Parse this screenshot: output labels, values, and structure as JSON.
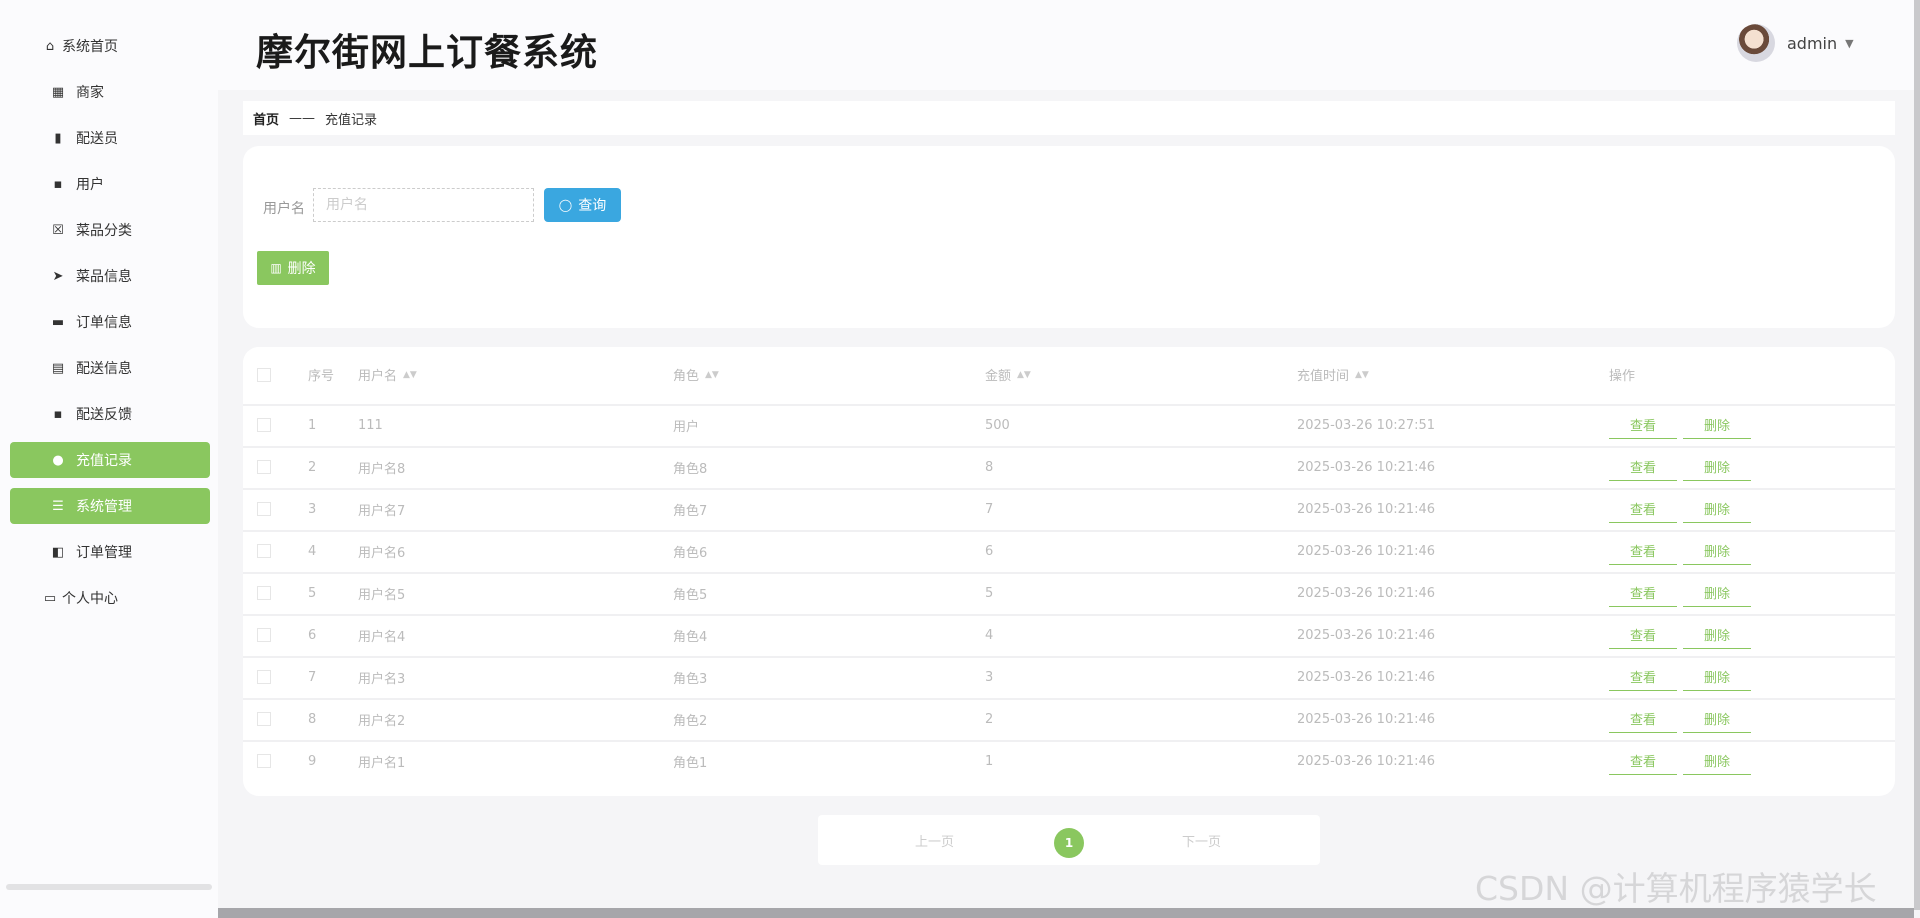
{
  "sidebar": {
    "items": [
      {
        "label": "系统首页",
        "icon": "home-icon"
      },
      {
        "label": "商家",
        "icon": "grid-icon"
      },
      {
        "label": "配送员",
        "icon": "books-icon"
      },
      {
        "label": "用户",
        "icon": "grid-icon"
      },
      {
        "label": "菜品分类",
        "icon": "clipboard-x-icon"
      },
      {
        "label": "菜品信息",
        "icon": "send-icon"
      },
      {
        "label": "订单信息",
        "icon": "briefcase-icon"
      },
      {
        "label": "配送信息",
        "icon": "clipboard-icon"
      },
      {
        "label": "配送反馈",
        "icon": "grid-icon"
      },
      {
        "label": "充值记录",
        "icon": "user-icon"
      },
      {
        "label": "系统管理",
        "icon": "sliders-icon"
      },
      {
        "label": "订单管理",
        "icon": "wallet-icon"
      },
      {
        "label": "个人中心",
        "icon": "card-icon"
      }
    ]
  },
  "header": {
    "title": "摩尔街网上订餐系统",
    "username": "admin"
  },
  "breadcrumb": {
    "home": "首页",
    "separator": "——",
    "current": "充值记录"
  },
  "search": {
    "label": "用户名",
    "placeholder": "用户名",
    "query_label": "查询",
    "delete_label": "删除"
  },
  "table": {
    "headers": {
      "index": "序号",
      "username": "用户名",
      "role": "角色",
      "amount": "金额",
      "time": "充值时间",
      "actions": "操作"
    },
    "view_label": "查看",
    "delete_label": "删除",
    "rows": [
      {
        "index": "1",
        "username": "111",
        "role": "用户",
        "amount": "500",
        "time": "2025-03-26 10:27:51"
      },
      {
        "index": "2",
        "username": "用户名8",
        "role": "角色8",
        "amount": "8",
        "time": "2025-03-26 10:21:46"
      },
      {
        "index": "3",
        "username": "用户名7",
        "role": "角色7",
        "amount": "7",
        "time": "2025-03-26 10:21:46"
      },
      {
        "index": "4",
        "username": "用户名6",
        "role": "角色6",
        "amount": "6",
        "time": "2025-03-26 10:21:46"
      },
      {
        "index": "5",
        "username": "用户名5",
        "role": "角色5",
        "amount": "5",
        "time": "2025-03-26 10:21:46"
      },
      {
        "index": "6",
        "username": "用户名4",
        "role": "角色4",
        "amount": "4",
        "time": "2025-03-26 10:21:46"
      },
      {
        "index": "7",
        "username": "用户名3",
        "role": "角色3",
        "amount": "3",
        "time": "2025-03-26 10:21:46"
      },
      {
        "index": "8",
        "username": "用户名2",
        "role": "角色2",
        "amount": "2",
        "time": "2025-03-26 10:21:46"
      },
      {
        "index": "9",
        "username": "用户名1",
        "role": "角色1",
        "amount": "1",
        "time": "2025-03-26 10:21:46"
      }
    ]
  },
  "pagination": {
    "prev": "上一页",
    "current": "1",
    "next": "下一页"
  },
  "watermark": "CSDN @计算机程序猿学长",
  "colors": {
    "accent_green": "#8ac75f",
    "query_blue": "#3aa7e0"
  }
}
